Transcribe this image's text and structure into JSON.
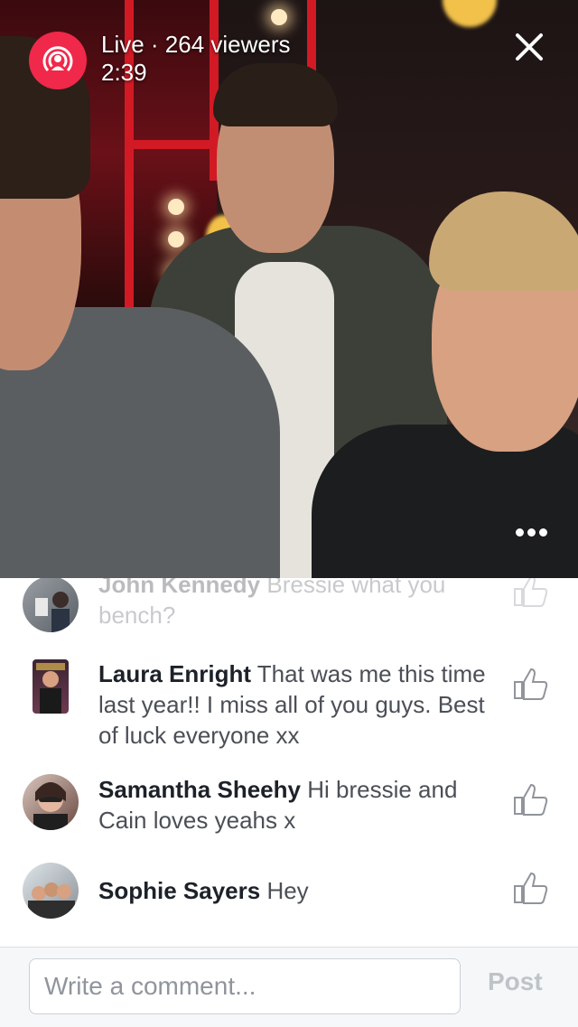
{
  "live": {
    "status": "Live · 264 viewers",
    "elapsed": "2:39",
    "badge_color": "#f02849"
  },
  "icons": {
    "live": "live-broadcast-icon",
    "close": "close-icon",
    "more": "more-options-icon",
    "like": "thumbs-up-icon"
  },
  "comments": [
    {
      "name": "John Kennedy",
      "text": "Bressie what you bench?"
    },
    {
      "name": "Laura Enright",
      "text": "That was me this time last year!! I miss all of you guys. Best of luck everyone xx"
    },
    {
      "name": "Samantha Sheehy",
      "text": "Hi bressie and Cain loves yeahs x"
    },
    {
      "name": "Sophie Sayers",
      "text": "Hey"
    }
  ],
  "composer": {
    "placeholder": "Write a comment...",
    "post_label": "Post"
  }
}
